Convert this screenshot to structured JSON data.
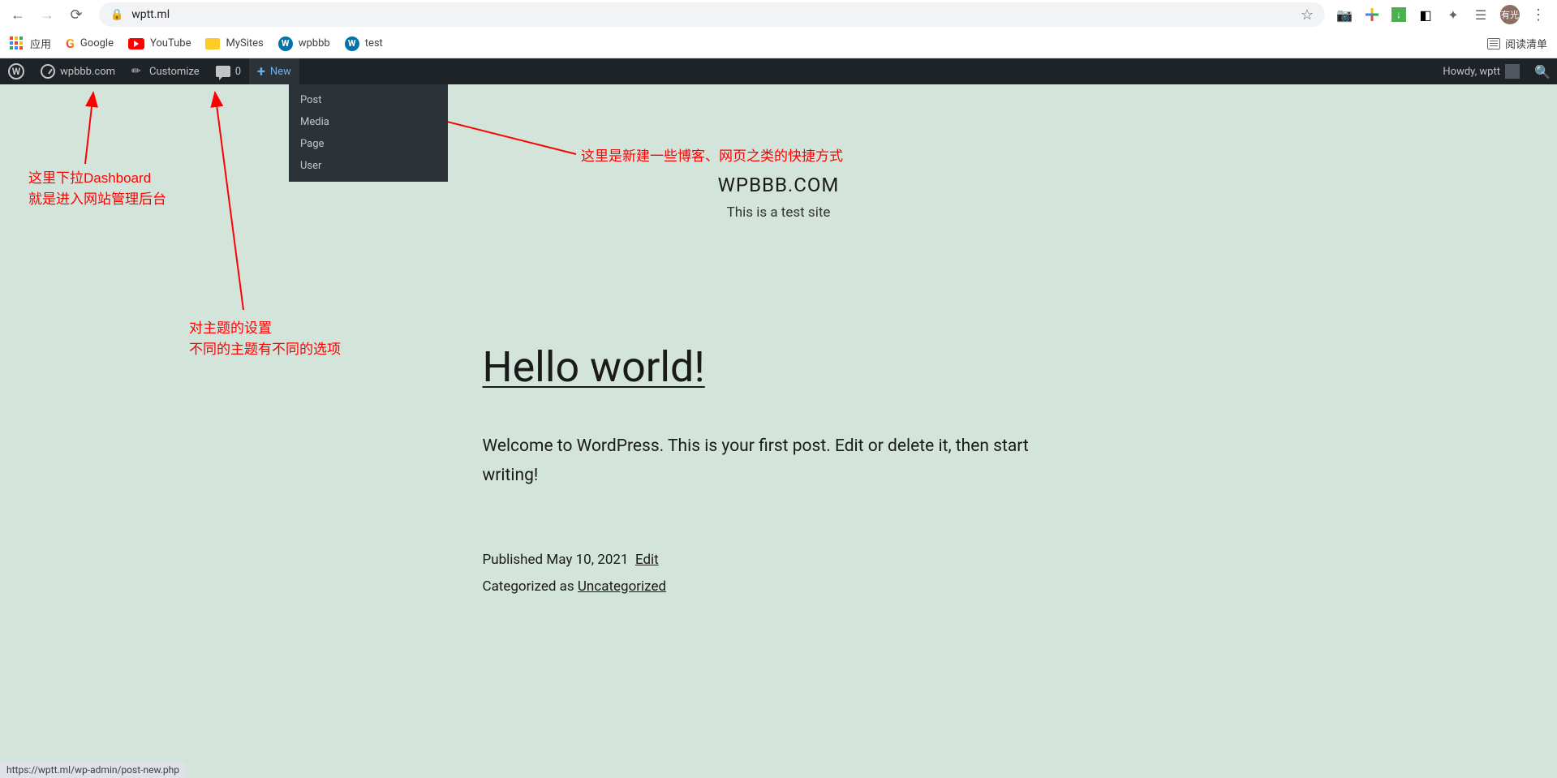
{
  "browser": {
    "url": "wptt.ml",
    "bookmarks": {
      "apps": "应用",
      "google": "Google",
      "youtube": "YouTube",
      "mysites": "MySites",
      "wpbbb": "wpbbb",
      "test": "test",
      "reading_list": "阅读清单"
    },
    "avatar_text": "有光",
    "status_bar": "https://wptt.ml/wp-admin/post-new.php"
  },
  "adminbar": {
    "site_name": "wpbbb.com",
    "customize": "Customize",
    "comments_count": "0",
    "new_label": "New",
    "howdy": "Howdy, wptt",
    "new_menu": {
      "post": "Post",
      "media": "Media",
      "page": "Page",
      "user": "User"
    }
  },
  "annotations": {
    "dashboard_line1": "这里下拉Dashboard",
    "dashboard_line2": "就是进入网站管理后台",
    "customize_line1": "对主题的设置",
    "customize_line2": "不同的主题有不同的选项",
    "new_shortcut": "这里是新建一些博客、网页之类的快捷方式"
  },
  "site": {
    "title": "WPBBB.COM",
    "tagline": "This is a test site"
  },
  "post": {
    "title": "Hello world!",
    "excerpt": "Welcome to WordPress. This is your first post. Edit or delete it, then start writing!",
    "published_prefix": "Published ",
    "published_date": "May 10, 2021",
    "edit_label": "Edit",
    "categorized_prefix": "Categorized as ",
    "category": "Uncategorized"
  }
}
